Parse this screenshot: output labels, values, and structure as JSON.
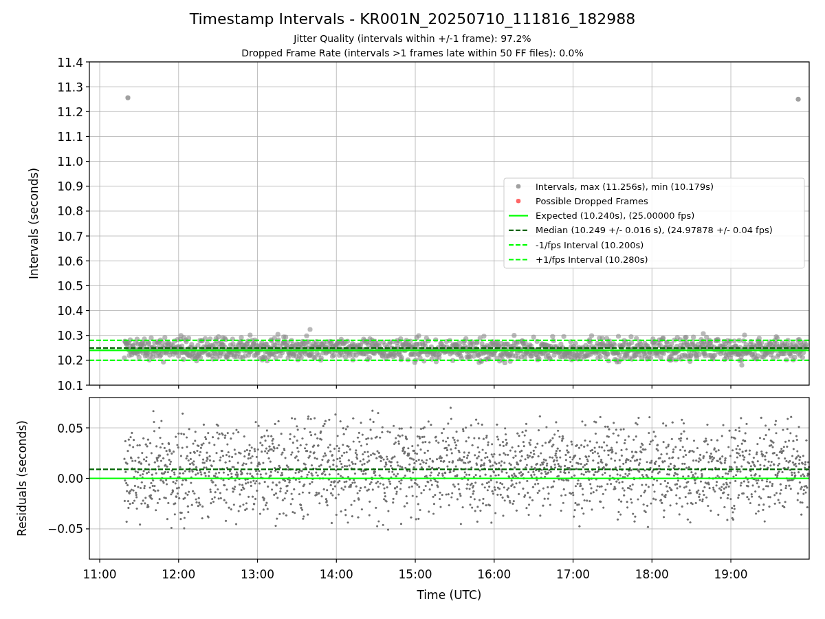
{
  "title": "Timestamp Intervals - KR001N_20250710_111816_182988",
  "subtitles": [
    "Jitter Quality (intervals within +/-1 frame): 97.2%",
    "Dropped Frame Rate (intervals >1 frames late within 50 FF files): 0.0%"
  ],
  "interval_plot": {
    "chart_data": {
      "type": "scatter",
      "ylabel": "Intervals (seconds)",
      "xlim": [
        10.869,
        19.993
      ],
      "ylim": [
        10.1,
        11.4
      ],
      "grid": true,
      "legend": "center right",
      "yticks": [
        {
          "value": 10.1,
          "label": "10.1"
        },
        {
          "value": 10.2,
          "label": "10.2"
        },
        {
          "value": 10.3,
          "label": "10.3"
        },
        {
          "value": 10.4,
          "label": "10.4"
        },
        {
          "value": 10.5,
          "label": "10.5"
        },
        {
          "value": 10.6,
          "label": "10.6"
        },
        {
          "value": 10.7,
          "label": "10.7"
        },
        {
          "value": 10.8,
          "label": "10.8"
        },
        {
          "value": 10.9,
          "label": "10.9"
        },
        {
          "value": 11.0,
          "label": "11.0"
        },
        {
          "value": 11.1,
          "label": "11.1"
        },
        {
          "value": 11.2,
          "label": "11.2"
        },
        {
          "value": 11.3,
          "label": "11.3"
        },
        {
          "value": 11.4,
          "label": "11.4"
        }
      ],
      "x": [
        11.357,
        19.854
      ],
      "series": [
        {
          "name": "Intervals, max (11.256s), min (10.179s)",
          "color": "#a0a0a0",
          "values": [
            11.256,
            11.25
          ]
        }
      ],
      "ref_lines": [
        {
          "axis": "y",
          "value": 10.24,
          "color": "#00ff00",
          "label": "Expected (10.240s), (25.00000 fps)"
        },
        {
          "axis": "y",
          "value": 10.249,
          "color": "#006400",
          "label": "Median (10.249 +/- 0.016 s), (24.97878 +/- 0.04 fps)"
        },
        {
          "axis": "y",
          "value": 10.2,
          "color": "#00ff00",
          "label": "-1/fps Interval (10.200s)"
        },
        {
          "axis": "y",
          "value": 10.28,
          "color": "#00ff00",
          "label": "+1/fps Interval (10.280s)"
        }
      ]
    },
    "legend_markers": [
      {
        "color": "#ff6666",
        "label": "Possible Dropped Frames"
      }
    ]
  },
  "residual_plot": {
    "chart_data": {
      "type": "scatter",
      "xlabel": "Time (UTC)",
      "ylabel": "Residuals (seconds)",
      "xlim": [
        10.869,
        19.993
      ],
      "ylim": [
        -0.08,
        0.08
      ],
      "grid": true,
      "xticks": [
        {
          "value": 11,
          "label": "11:00"
        },
        {
          "value": 12,
          "label": "12:00"
        },
        {
          "value": 13,
          "label": "13:00"
        },
        {
          "value": 14,
          "label": "14:00"
        },
        {
          "value": 15,
          "label": "15:00"
        },
        {
          "value": 16,
          "label": "16:00"
        },
        {
          "value": 17,
          "label": "17:00"
        },
        {
          "value": 18,
          "label": "18:00"
        },
        {
          "value": 19,
          "label": "19:00"
        }
      ],
      "yticks": [
        {
          "value": -0.05,
          "label": "−0.05"
        },
        {
          "value": 0,
          "label": "0.00"
        },
        {
          "value": 0.05,
          "label": "0.05"
        }
      ],
      "ref_lines": [
        {
          "axis": "y",
          "value": 0,
          "color": "#00ff00"
        },
        {
          "axis": "y",
          "value": 0.009,
          "color": "#006400"
        }
      ]
    }
  }
}
